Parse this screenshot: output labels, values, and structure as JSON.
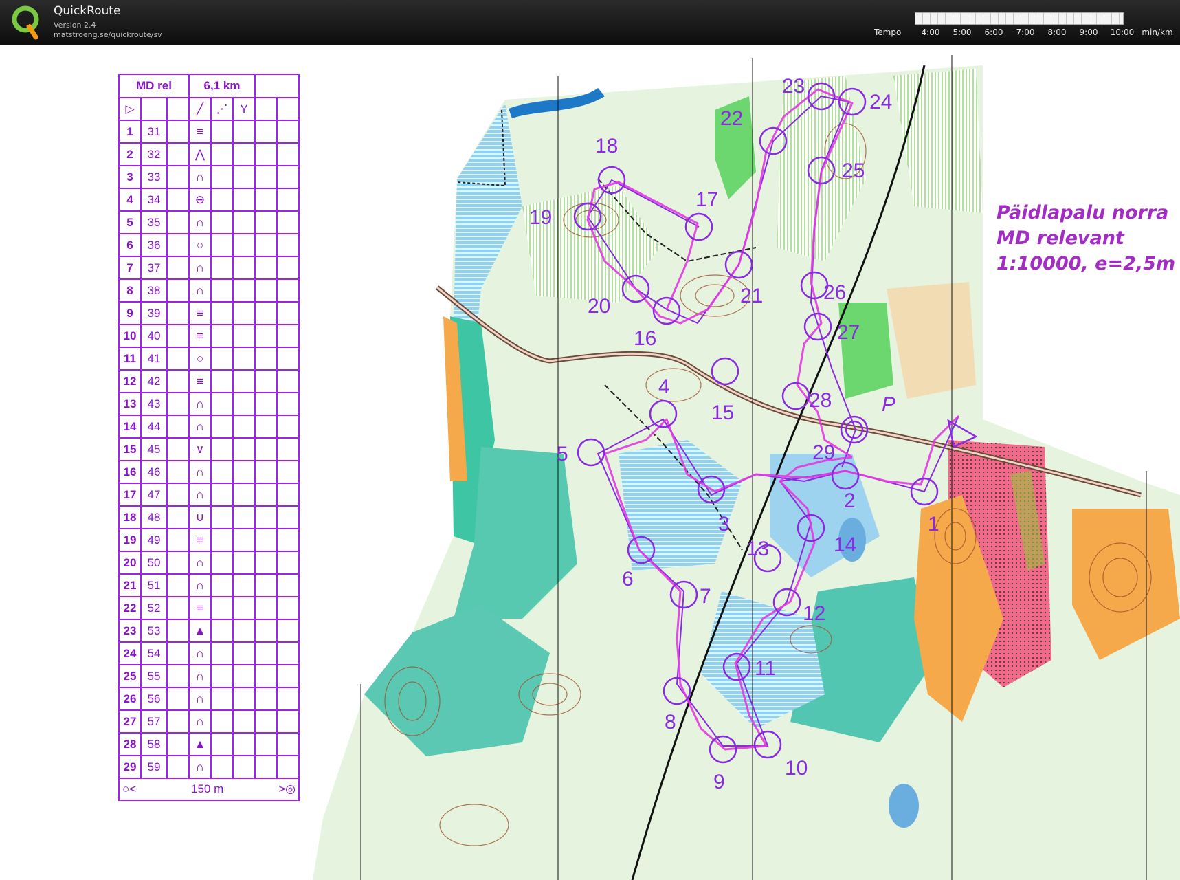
{
  "app": {
    "name": "QuickRoute",
    "version": "Version 2.4",
    "url": "matstroeng.se/quickroute/sv"
  },
  "tempo": {
    "label": "Tempo",
    "ticks": [
      "4:00",
      "5:00",
      "6:00",
      "7:00",
      "8:00",
      "9:00",
      "10:00"
    ],
    "unit": "min/km"
  },
  "map": {
    "title_lines": [
      "Päidlapalu norra",
      "MD relevant",
      "1:10000, e=2,5m"
    ],
    "start_marker_label": "P"
  },
  "legend": {
    "course": "MD rel",
    "length": "6,1 km",
    "finish_distance": "150 m",
    "rows": [
      {
        "n": "1",
        "code": "31",
        "feature": "≡"
      },
      {
        "n": "2",
        "code": "32",
        "feature": "⋀"
      },
      {
        "n": "3",
        "code": "33",
        "feature": "∩"
      },
      {
        "n": "4",
        "code": "34",
        "feature": "⊖"
      },
      {
        "n": "5",
        "code": "35",
        "feature": "∩"
      },
      {
        "n": "6",
        "code": "36",
        "feature": "○"
      },
      {
        "n": "7",
        "code": "37",
        "feature": "∩"
      },
      {
        "n": "8",
        "code": "38",
        "feature": "∩"
      },
      {
        "n": "9",
        "code": "39",
        "feature": "≡"
      },
      {
        "n": "10",
        "code": "40",
        "feature": "≡"
      },
      {
        "n": "11",
        "code": "41",
        "feature": "○"
      },
      {
        "n": "12",
        "code": "42",
        "feature": "≡"
      },
      {
        "n": "13",
        "code": "43",
        "feature": "∩"
      },
      {
        "n": "14",
        "code": "44",
        "feature": "∩"
      },
      {
        "n": "15",
        "code": "45",
        "feature": "∨"
      },
      {
        "n": "16",
        "code": "46",
        "feature": "∩"
      },
      {
        "n": "17",
        "code": "47",
        "feature": "∩"
      },
      {
        "n": "18",
        "code": "48",
        "feature": "∪"
      },
      {
        "n": "19",
        "code": "49",
        "feature": "≡"
      },
      {
        "n": "20",
        "code": "50",
        "feature": "∩"
      },
      {
        "n": "21",
        "code": "51",
        "feature": "∩"
      },
      {
        "n": "22",
        "code": "52",
        "feature": "≡"
      },
      {
        "n": "23",
        "code": "53",
        "feature": "▲"
      },
      {
        "n": "24",
        "code": "54",
        "feature": "∩"
      },
      {
        "n": "25",
        "code": "55",
        "feature": "∩"
      },
      {
        "n": "26",
        "code": "56",
        "feature": "∩"
      },
      {
        "n": "27",
        "code": "57",
        "feature": "∩"
      },
      {
        "n": "28",
        "code": "58",
        "feature": "▲"
      },
      {
        "n": "29",
        "code": "59",
        "feature": "∩"
      }
    ]
  },
  "controls": [
    {
      "label": "1"
    },
    {
      "label": "2"
    },
    {
      "label": "3"
    },
    {
      "label": "4"
    },
    {
      "label": "5"
    },
    {
      "label": "6"
    },
    {
      "label": "7"
    },
    {
      "label": "8"
    },
    {
      "label": "9"
    },
    {
      "label": "10"
    },
    {
      "label": "11"
    },
    {
      "label": "12"
    },
    {
      "label": "13"
    },
    {
      "label": "14"
    },
    {
      "label": "15"
    },
    {
      "label": "16"
    },
    {
      "label": "17"
    },
    {
      "label": "18"
    },
    {
      "label": "19"
    },
    {
      "label": "20"
    },
    {
      "label": "21"
    },
    {
      "label": "22"
    },
    {
      "label": "23"
    },
    {
      "label": "24"
    },
    {
      "label": "25"
    },
    {
      "label": "26"
    },
    {
      "label": "27"
    },
    {
      "label": "28"
    },
    {
      "label": "29"
    }
  ],
  "colors": {
    "course_purple": "#a020f0",
    "route_magenta": "#e040e0",
    "forest_green": "#5fd16e",
    "water_blue": "#8ec9ee",
    "open_orange": "#f5a94a"
  }
}
